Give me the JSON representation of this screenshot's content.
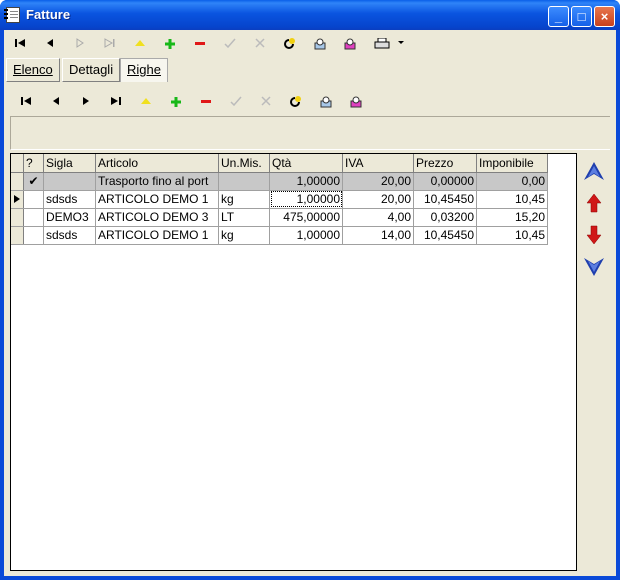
{
  "window": {
    "title": "Fatture",
    "controls": {
      "minimize": "_",
      "maximize": "□",
      "close": "×"
    }
  },
  "toolbar_main": {
    "items": [
      {
        "name": "first-record-icon"
      },
      {
        "name": "prior-record-icon"
      },
      {
        "name": "next-record-icon"
      },
      {
        "name": "last-record-icon"
      },
      {
        "name": "edit-icon"
      },
      {
        "name": "add-icon"
      },
      {
        "name": "delete-icon"
      },
      {
        "name": "post-icon"
      },
      {
        "name": "cancel-icon"
      },
      {
        "name": "refresh-icon"
      },
      {
        "name": "search-icon"
      },
      {
        "name": "filter-icon"
      },
      {
        "name": "print-icon"
      },
      {
        "name": "dropdown-arrow-icon"
      }
    ]
  },
  "tabs": [
    {
      "label": "Elenco",
      "active": false
    },
    {
      "label": "Dettagli",
      "active": false
    },
    {
      "label": "Righe",
      "active": true
    }
  ],
  "grid": {
    "columns": [
      "?",
      "Sigla",
      "Articolo",
      "Un.Mis.",
      "Qtà",
      "IVA",
      "Prezzo",
      "Imponibile"
    ],
    "rows": [
      {
        "check": "✔",
        "sigla": "",
        "articolo": "Trasporto fino al port",
        "um": "",
        "qta": "1,00000",
        "iva": "20,00",
        "prezzo": "0,00000",
        "imponibile": "0,00"
      },
      {
        "check": "",
        "sigla": "sdsds",
        "articolo": "ARTICOLO DEMO 1",
        "um": "kg",
        "qta": "1,00000",
        "iva": "20,00",
        "prezzo": "10,45450",
        "imponibile": "10,45"
      },
      {
        "check": "",
        "sigla": "DEMO3",
        "articolo": "ARTICOLO DEMO 3",
        "um": "LT",
        "qta": "475,00000",
        "iva": "4,00",
        "prezzo": "0,03200",
        "imponibile": "15,20"
      },
      {
        "check": "",
        "sigla": "sdsds",
        "articolo": "ARTICOLO DEMO 1",
        "um": "kg",
        "qta": "1,00000",
        "iva": "14,00",
        "prezzo": "10,45450",
        "imponibile": "10,45"
      }
    ]
  },
  "colors": {
    "titlebar": "#0a54e0",
    "face": "#ece9d8",
    "selected_row": "#c8c8c8",
    "arrow_blue": "#1f3fae",
    "arrow_red": "#d01818"
  }
}
